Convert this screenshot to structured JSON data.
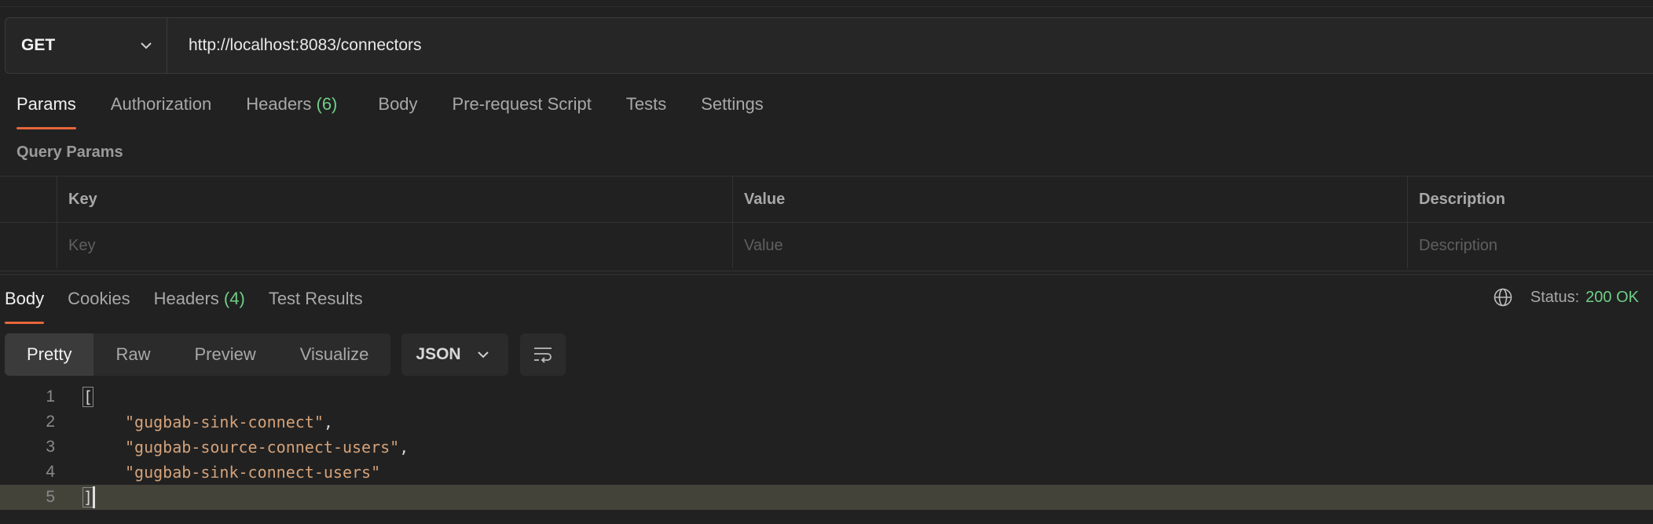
{
  "request": {
    "method": "GET",
    "url": "http://localhost:8083/connectors"
  },
  "request_tabs": [
    {
      "label": "Params",
      "active": true
    },
    {
      "label": "Authorization"
    },
    {
      "label": "Headers",
      "count": "(6)"
    },
    {
      "label": "Body"
    },
    {
      "label": "Pre-request Script"
    },
    {
      "label": "Tests"
    },
    {
      "label": "Settings"
    }
  ],
  "query_params": {
    "title": "Query Params",
    "columns": [
      "Key",
      "Value",
      "Description"
    ],
    "placeholders": [
      "Key",
      "Value",
      "Description"
    ]
  },
  "response_tabs": [
    {
      "label": "Body",
      "active": true
    },
    {
      "label": "Cookies"
    },
    {
      "label": "Headers",
      "count": "(4)"
    },
    {
      "label": "Test Results"
    }
  ],
  "status": {
    "label": "Status:",
    "value": "200 OK",
    "icon": "globe-icon"
  },
  "view_modes": [
    "Pretty",
    "Raw",
    "Preview",
    "Visualize"
  ],
  "format": "JSON",
  "code_lines": [
    {
      "n": "1",
      "text": "["
    },
    {
      "n": "2",
      "text": "\"gugbab-sink-connect\""
    },
    {
      "n": "3",
      "text": "\"gugbab-source-connect-users\""
    },
    {
      "n": "4",
      "text": "\"gugbab-sink-connect-users\""
    },
    {
      "n": "5",
      "text": "]"
    }
  ],
  "colors": {
    "accent": "#e8663a",
    "success": "#6fcf87",
    "string": "#d4a27a",
    "highlight_line": "#43433a"
  }
}
